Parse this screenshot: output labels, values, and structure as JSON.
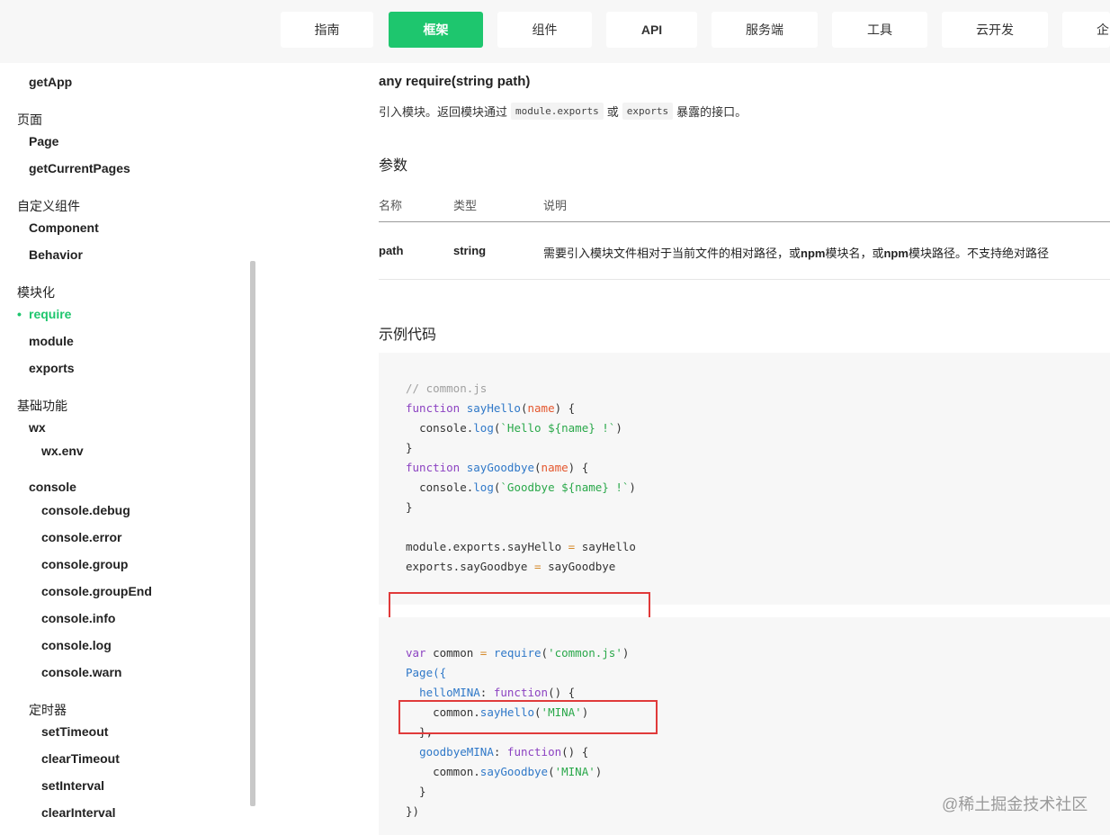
{
  "nav": {
    "items": [
      {
        "label": "指南"
      },
      {
        "label": "框架"
      },
      {
        "label": "组件"
      },
      {
        "label": "API"
      },
      {
        "label": "服务端"
      },
      {
        "label": "工具"
      },
      {
        "label": "云开发"
      },
      {
        "label": "企"
      }
    ],
    "active": "框架"
  },
  "sidebar": {
    "getApp": "getApp",
    "page_group": "页面",
    "page": "Page",
    "getCurrentPages": "getCurrentPages",
    "custom_group": "自定义组件",
    "component": "Component",
    "behavior": "Behavior",
    "module_group": "模块化",
    "bullet": "•",
    "require": "require",
    "module": "module",
    "exports": "exports",
    "basic_group": "基础功能",
    "wx": "wx",
    "wx_env": "wx.env",
    "console": "console",
    "console_debug": "console.debug",
    "console_error": "console.error",
    "console_group": "console.group",
    "console_groupEnd": "console.groupEnd",
    "console_info": "console.info",
    "console_log": "console.log",
    "console_warn": "console.warn",
    "timer_group": "定时器",
    "setTimeout": "setTimeout",
    "clearTimeout": "clearTimeout",
    "setInterval": "setInterval",
    "clearInterval": "clearInterval"
  },
  "main": {
    "title": "any require(string path)",
    "desc_before": "引入模块。返回模块通过",
    "desc_code1": "module.exports",
    "desc_mid": "或",
    "desc_code2": "exports",
    "desc_after": "暴露的接口。",
    "params_title": "参数",
    "table": {
      "headers": [
        "名称",
        "类型",
        "说明"
      ],
      "row": {
        "name": "path",
        "type": "string",
        "desc_part1": "需要引入模块文件相对于当前文件的相对路径，或",
        "desc_npm1": "npm",
        "desc_part2": "模块名，或",
        "desc_npm2": "npm",
        "desc_part3": "模块路径。不支持绝对路径"
      }
    },
    "example_title": "示例代码"
  },
  "code1": {
    "comment": "// common.js",
    "kw_function": "function",
    "sayHello": "sayHello",
    "sayGoodbye": "sayGoodbye",
    "param_name": "name",
    "console_dot": "console.",
    "log": "log",
    "hello_str": "`Hello ${name} !`",
    "goodbye_str": "`Goodbye ${name} !`",
    "export_line1_left": "module.exports.sayHello",
    "export_line1_right": "sayHello",
    "export_line2_left": "exports.sayGoodbye",
    "export_line2_right": "sayGoodbye"
  },
  "code2": {
    "kw_var": "var",
    "common": "common",
    "require": "require",
    "require_arg": "'common.js'",
    "page_call": "Page({",
    "helloMINA": "helloMINA",
    "goodbyeMINA": "goodbyeMINA",
    "kw_function": "function",
    "common_dot": "common.",
    "sayHello": "sayHello",
    "sayGoodbye": "sayGoodbye",
    "mina_arg": "'MINA'",
    "close_obj": "})"
  },
  "watermark": "@稀土掘金技术社区",
  "colors": {
    "accent": "#1ec66e",
    "highlight_box": "#e03a3a"
  }
}
